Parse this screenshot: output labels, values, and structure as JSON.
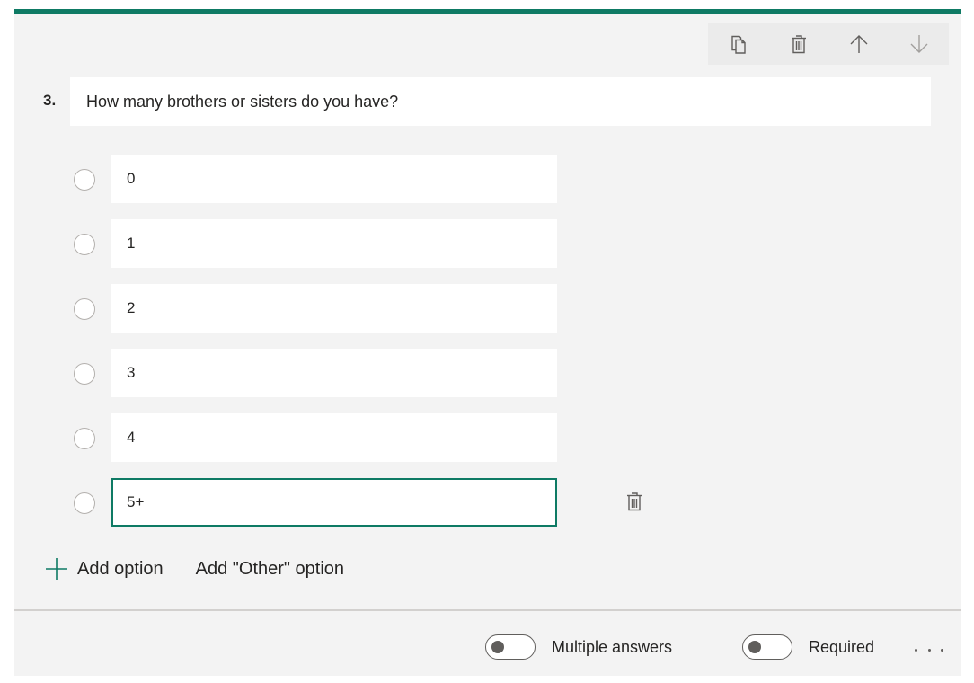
{
  "accent_color": "#0e7a64",
  "toolbar": {
    "buttons": [
      {
        "icon": "copy-icon",
        "label": "Copy question"
      },
      {
        "icon": "trash-icon",
        "label": "Delete question"
      },
      {
        "icon": "arrow-up-icon",
        "label": "Move question up"
      },
      {
        "icon": "arrow-down-icon",
        "label": "Move question down"
      }
    ]
  },
  "question": {
    "number": "3.",
    "title": "How many brothers or sisters do you have?"
  },
  "options": [
    {
      "value": "0"
    },
    {
      "value": "1"
    },
    {
      "value": "2"
    },
    {
      "value": "3"
    },
    {
      "value": "4"
    },
    {
      "value": "5+",
      "active": true
    }
  ],
  "actions": {
    "add_option": "Add option",
    "add_other_option": "Add \"Other\" option"
  },
  "footer": {
    "multiple_answers_label": "Multiple answers",
    "multiple_answers_on": false,
    "required_label": "Required",
    "required_on": false,
    "more_icon": "ellipsis-icon"
  }
}
